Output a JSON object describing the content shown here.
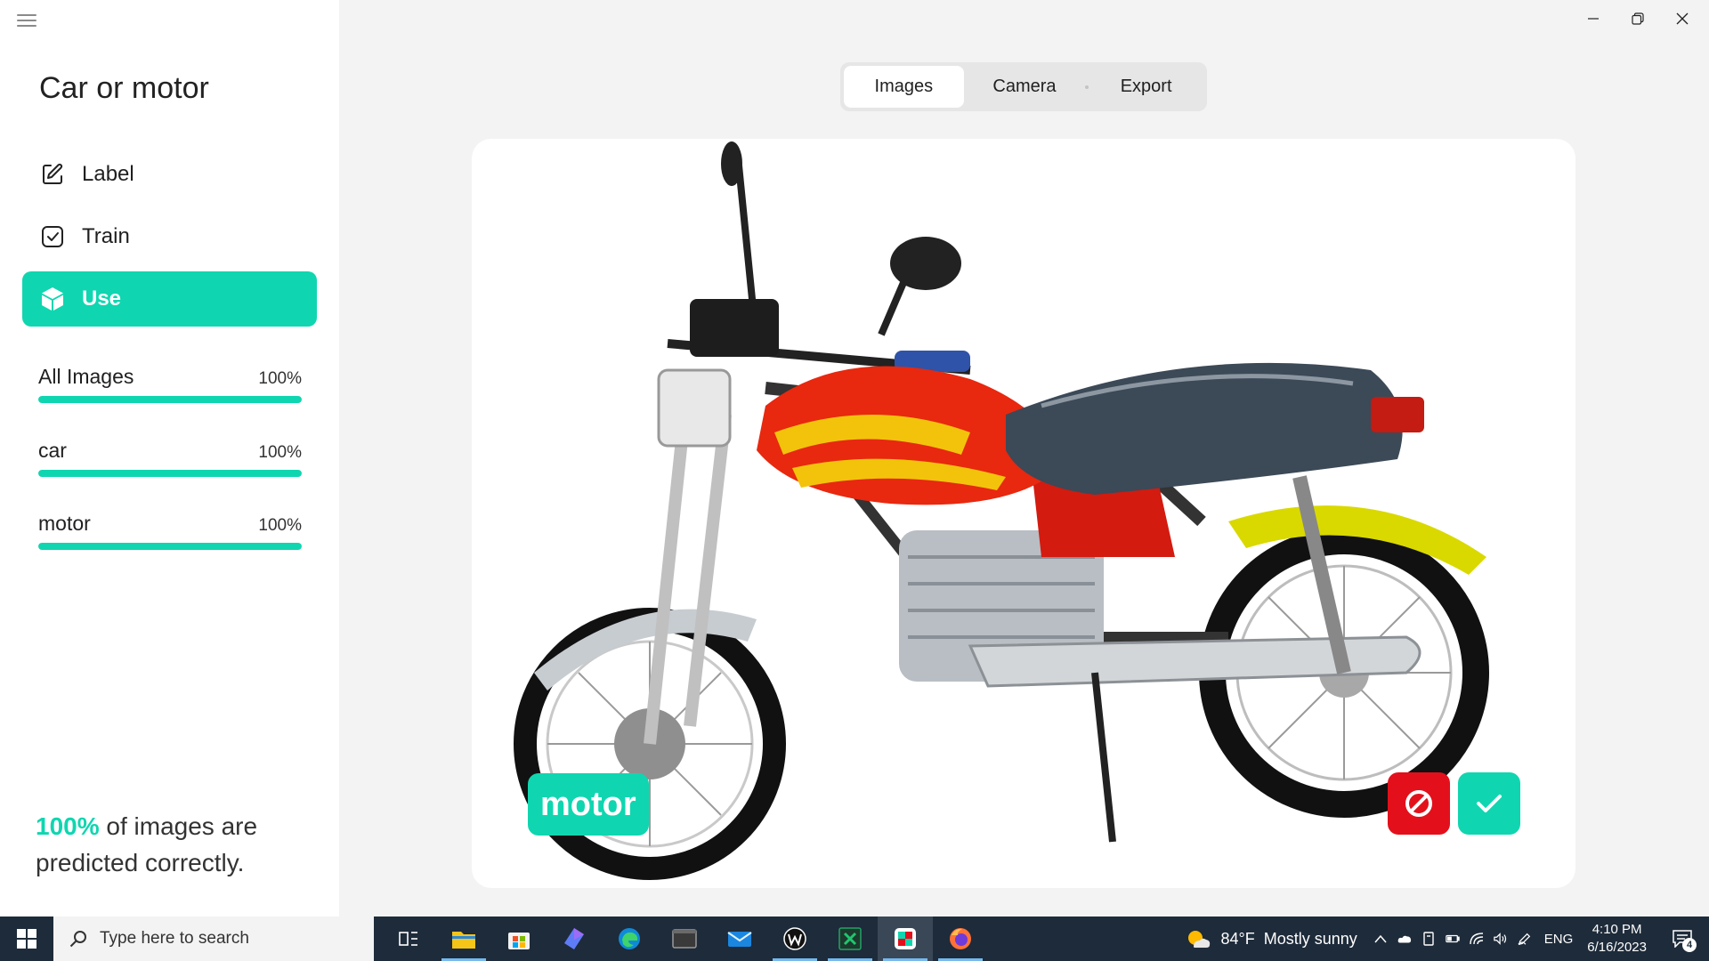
{
  "app": {
    "project_title": "Car or motor"
  },
  "nav": {
    "items": [
      {
        "label": "Label",
        "icon": "edit-icon"
      },
      {
        "label": "Train",
        "icon": "checkbox-icon"
      },
      {
        "label": "Use",
        "icon": "cube-icon",
        "active": true
      }
    ]
  },
  "stats": [
    {
      "name": "All Images",
      "percent_text": "100%",
      "accuracy": 1.0
    },
    {
      "name": "car",
      "percent_text": "100%",
      "accuracy": 1.0
    },
    {
      "name": "motor",
      "percent_text": "100%",
      "accuracy": 1.0
    }
  ],
  "summary": {
    "percent": "100%",
    "text": "of images are predicted correctly."
  },
  "tabs": [
    {
      "label": "Images",
      "active": true
    },
    {
      "label": "Camera"
    },
    {
      "label": "Export"
    }
  ],
  "prediction": {
    "label": "motor",
    "image_subject": "motorcycle-photo"
  },
  "colors": {
    "accent": "#0fd6b0",
    "wrong": "#e3101b",
    "taskbar": "#1e2b3a"
  },
  "taskbar": {
    "search_placeholder": "Type here to search",
    "apps": [
      "task-view-icon",
      "file-explorer-icon",
      "microsoft-store-icon",
      "copilot-icon",
      "edge-icon",
      "terminal-icon",
      "mail-icon",
      "wordpad-icon",
      "excel-icon",
      "lobe-app-icon",
      "firefox-icon"
    ],
    "weather": {
      "temp": "84°F",
      "condition": "Mostly sunny"
    },
    "language": "ENG",
    "time": "4:10 PM",
    "date": "6/16/2023",
    "notification_count": "4"
  }
}
